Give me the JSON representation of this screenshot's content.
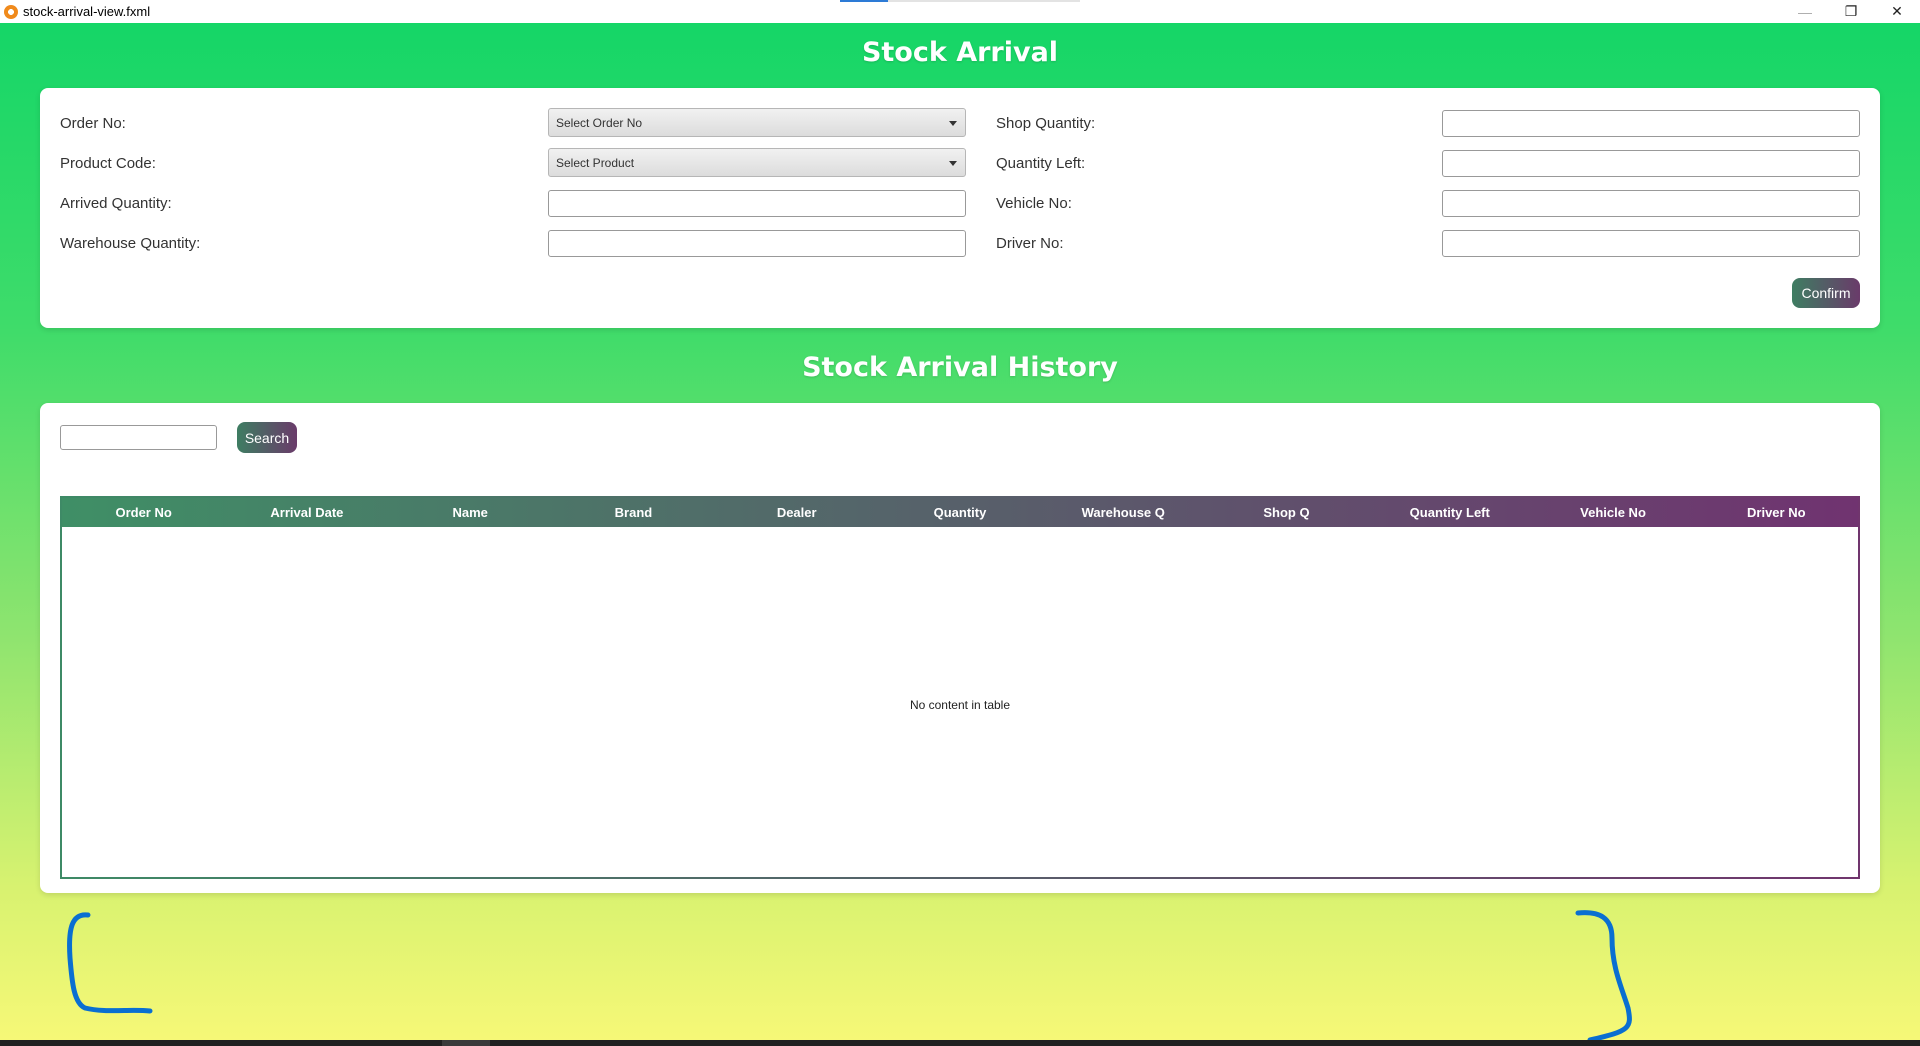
{
  "window": {
    "title": "stock-arrival-view.fxml",
    "controls": {
      "minimize": "—",
      "restore": "❐",
      "close": "✕"
    }
  },
  "header": {
    "title": "Stock Arrival"
  },
  "form": {
    "order_no_label": "Order No:",
    "order_no_placeholder": "Select Order No",
    "product_code_label": "Product Code:",
    "product_code_placeholder": "Select Product",
    "arrived_qty_label": "Arrived Quantity:",
    "warehouse_qty_label": "Warehouse Quantity:",
    "shop_qty_label": "Shop Quantity:",
    "qty_left_label": "Quantity Left:",
    "vehicle_no_label": "Vehicle No:",
    "driver_no_label": "Driver No:",
    "confirm_label": "Confirm"
  },
  "history": {
    "title": "Stock Arrival History",
    "search_value": "",
    "search_label": "Search",
    "columns": [
      "Order No",
      "Arrival Date",
      "Name",
      "Brand",
      "Dealer",
      "Quantity",
      "Warehouse Q",
      "Shop Q",
      "Quantity Left",
      "Vehicle No",
      "Driver No"
    ],
    "rows": [],
    "empty_message": "No content in table"
  },
  "colors": {
    "accent_start": "#3e7d62",
    "accent_end": "#6a3b6a",
    "bg_top": "#15d667",
    "bg_bottom": "#f6f877",
    "annotation": "#0a6fd1"
  }
}
